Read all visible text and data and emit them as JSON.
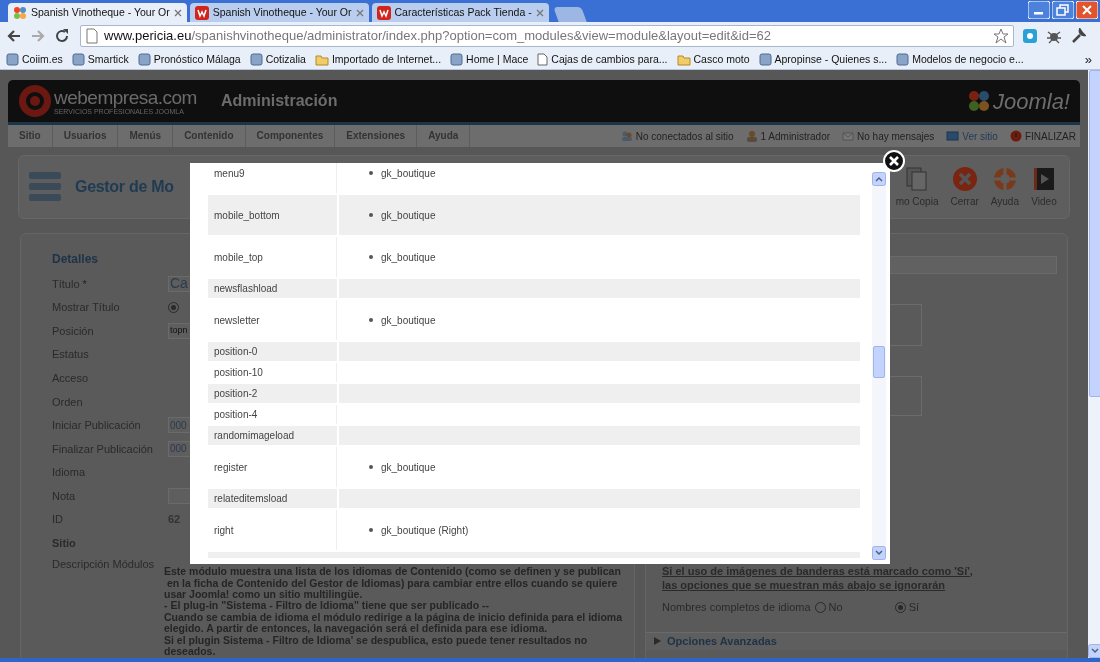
{
  "browser": {
    "tabs": [
      {
        "title": "Spanish Vinotheque - Your Or",
        "selected": true,
        "kind": "joomla"
      },
      {
        "title": "Spanish Vinotheque - Your Or",
        "selected": false,
        "kind": "webempresa"
      },
      {
        "title": "Características Pack Tienda -",
        "selected": false,
        "kind": "webempresa"
      }
    ],
    "address": {
      "host": "www.pericia.eu",
      "path": "/spanishvinotheque/administrator/index.php?option=com_modules&view=module&layout=edit&id=62"
    },
    "bookmarks": [
      {
        "label": "Coiim.es",
        "kind": "site"
      },
      {
        "label": "Smartick",
        "kind": "site"
      },
      {
        "label": "Pronóstico Málaga",
        "kind": "site"
      },
      {
        "label": "Cotizalia",
        "kind": "site"
      },
      {
        "label": "Importado de Internet...",
        "kind": "folder"
      },
      {
        "label": "Home | Mace",
        "kind": "site"
      },
      {
        "label": "Cajas de cambios para...",
        "kind": "page"
      },
      {
        "label": "Casco moto",
        "kind": "folder"
      },
      {
        "label": "Apropinse - Quienes s...",
        "kind": "site"
      },
      {
        "label": "Modelos de negocio e...",
        "kind": "site"
      }
    ],
    "bookmarks_overflow": "»"
  },
  "header": {
    "brand": "webempresa.com",
    "tagline": "SERVICIOS PROFESIONALES JOOMLA",
    "title": "Administración",
    "logo": "Joomla!"
  },
  "menu": [
    "Sitio",
    "Usuarios",
    "Menús",
    "Contenido",
    "Componentes",
    "Extensiones",
    "Ayuda"
  ],
  "status": [
    {
      "label": "No conectados al sitio",
      "kind": "users"
    },
    {
      "label": "1 Administrador",
      "kind": "admin"
    },
    {
      "label": "No hay mensajes",
      "kind": "mail"
    },
    {
      "label": "Ver sitio",
      "kind": "view"
    },
    {
      "label": "FINALIZAR",
      "kind": "logout"
    }
  ],
  "toolbar": {
    "title": "Gestor de Mo",
    "buttons": [
      {
        "label": "mo Copia",
        "kind": "copy"
      },
      {
        "label": "Cerrar",
        "kind": "close"
      },
      {
        "label": "Ayuda",
        "kind": "help"
      },
      {
        "label": "Video",
        "kind": "video"
      }
    ]
  },
  "details": {
    "legend": "Detalles",
    "fields": [
      {
        "label": "Título",
        "required": true,
        "required_mark": "*",
        "kind": "input",
        "value": "Ca"
      },
      {
        "label": "Mostrar Título",
        "kind": "radio",
        "checked": true
      },
      {
        "label": "Posición",
        "kind": "small_input",
        "value": "topn"
      },
      {
        "label": "Estatus",
        "kind": "none"
      },
      {
        "label": "Acceso",
        "kind": "none"
      },
      {
        "label": "Orden",
        "kind": "none"
      },
      {
        "label": "Iniciar Publicación",
        "kind": "input",
        "value": "000"
      },
      {
        "label": "Finalizar Publicación",
        "kind": "input",
        "value": "000"
      },
      {
        "label": "Idioma",
        "kind": "none"
      },
      {
        "label": "Nota",
        "kind": "input"
      },
      {
        "label": "ID",
        "kind": "text",
        "value": "62"
      },
      {
        "label": "Sitio",
        "kind": "heading"
      },
      {
        "label": "Descripción Módulos",
        "kind": "description",
        "lines": [
          "Este módulo muestra una lista de los idiomas de Contenido (como se definen y se publican",
          " en la ficha de Contenido del Gestor de Idiomas) para cambiar entre ellos cuando se quiere",
          "usar Joomla! como un sitio multilingüe.",
          "- El plug-in \"Sistema - Filtro de Idioma\" tiene que ser publicado --",
          "Cuando se cambia de idioma el módulo redirige a la página de inicio definida para el idioma",
          "elegido. A partir de entonces, la navegación será el definida para ese idioma.",
          "Si el plugin Sistema - Filtro de Idioma' se despublica, esto puede tener resultados no",
          "deseados."
        ]
      }
    ]
  },
  "options": {
    "notice": [
      "Si el uso de imágenes de banderas está marcado como 'Sí',",
      "las opciones que se muestran más abajo se ignorarán"
    ],
    "full_names": {
      "label": "Nombres completos de idioma",
      "choices": [
        {
          "label": "No",
          "selected": false
        },
        {
          "label": "Sí",
          "selected": true
        }
      ]
    },
    "advanced": "Opciones Avanzadas"
  },
  "modal": {
    "rows": [
      {
        "position": "menu9",
        "templates": [
          "gk_boutique"
        ]
      },
      {
        "position": "mobile_bottom",
        "templates": [
          "gk_boutique"
        ]
      },
      {
        "position": "mobile_top",
        "templates": [
          "gk_boutique"
        ]
      },
      {
        "position": "newsflashload",
        "templates": []
      },
      {
        "position": "newsletter",
        "templates": [
          "gk_boutique"
        ]
      },
      {
        "position": "position-0",
        "templates": []
      },
      {
        "position": "position-10",
        "templates": []
      },
      {
        "position": "position-2",
        "templates": []
      },
      {
        "position": "position-4",
        "templates": []
      },
      {
        "position": "randomimageload",
        "templates": []
      },
      {
        "position": "register",
        "templates": [
          "gk_boutique"
        ]
      },
      {
        "position": "relateditemsload",
        "templates": []
      },
      {
        "position": "right",
        "templates": [
          "gk_boutique (Right)"
        ]
      }
    ]
  }
}
